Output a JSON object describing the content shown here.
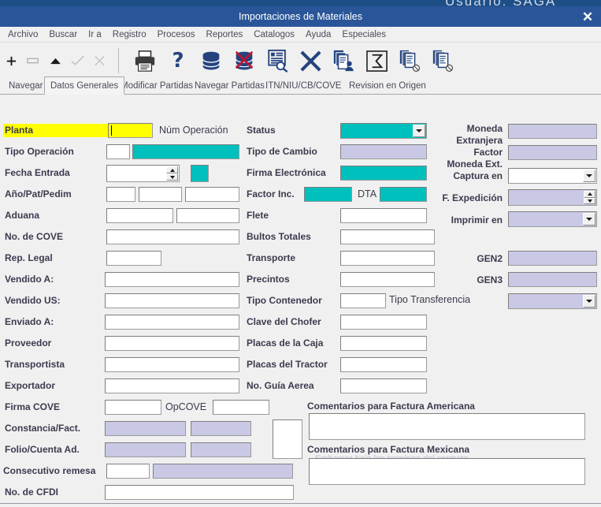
{
  "window": {
    "title": "Importaciones de Materiales",
    "close_label": "✕",
    "ghost_behind_title": "Usuario:  SAGA"
  },
  "menu": {
    "items": [
      "Archivo",
      "Buscar",
      "Ir a",
      "Registro",
      "Procesos",
      "Reportes",
      "Catalogos",
      "Ayuda",
      "Especiales"
    ]
  },
  "toolbar": {
    "nav_buttons": [
      {
        "name": "add-record-icon",
        "glyph": "➕",
        "enabled": true
      },
      {
        "name": "delete-record-icon",
        "glyph": "▭",
        "enabled": false
      },
      {
        "name": "previous-record-icon",
        "glyph": "▲",
        "enabled": true
      },
      {
        "name": "commit-icon",
        "glyph": "✓",
        "enabled": false
      },
      {
        "name": "rollback-icon",
        "glyph": "✗",
        "enabled": false
      }
    ],
    "action_buttons": [
      {
        "name": "print-icon"
      },
      {
        "name": "help-question-icon"
      },
      {
        "name": "database-icon"
      },
      {
        "name": "database-delete-icon"
      },
      {
        "name": "query-list-icon"
      },
      {
        "name": "close-x-icon"
      },
      {
        "name": "document-user-icon"
      },
      {
        "name": "sum-sigma-icon"
      },
      {
        "name": "copy-cancel-icon"
      },
      {
        "name": "document-cancel-icon"
      }
    ]
  },
  "tabs": [
    {
      "label": "Navegar",
      "selected": false
    },
    {
      "label": "Datos Generales",
      "selected": true
    },
    {
      "label": "Modificar Partidas",
      "selected": false
    },
    {
      "label": "Navegar Partidas",
      "selected": false
    },
    {
      "label": "ITN/NIU/CB/COVE",
      "selected": false
    },
    {
      "label": "Revision en Origen",
      "selected": false
    }
  ],
  "form": {
    "col_left": [
      {
        "label": "Planta",
        "value": "",
        "style": "yellow",
        "highlight": true
      },
      {
        "label": "Tipo Operación",
        "value": ""
      },
      {
        "label": "Fecha Entrada",
        "value": ""
      },
      {
        "label": "Año/Pat/Pedim",
        "value": ""
      },
      {
        "label": "Aduana",
        "value": ""
      },
      {
        "label": "No. de COVE",
        "value": ""
      },
      {
        "label": "Rep. Legal",
        "value": ""
      },
      {
        "label": "Vendido A:",
        "value": ""
      },
      {
        "label": "Vendido US:",
        "value": ""
      },
      {
        "label": "Enviado A:",
        "value": ""
      },
      {
        "label": "Proveedor",
        "value": ""
      },
      {
        "label": "Transportista",
        "value": ""
      },
      {
        "label": "Exportador",
        "value": ""
      },
      {
        "label": "Firma COVE",
        "value": ""
      },
      {
        "label": "Constancia/Fact.",
        "value": ""
      },
      {
        "label": "Folio/Cuenta Ad.",
        "value": ""
      },
      {
        "label": "Consecutivo remesa",
        "value": ""
      },
      {
        "label": "No. de CFDI",
        "value": ""
      }
    ],
    "inline_labels": {
      "num_operacion": "Núm Operación",
      "opcove": "OpCOVE",
      "dta": "DTA",
      "tipo_transferencia": "Tipo Transferencia"
    },
    "col_mid": [
      {
        "label": "Status",
        "value": ""
      },
      {
        "label": "Tipo de Cambio",
        "value": ""
      },
      {
        "label": "Firma Electrónica",
        "value": ""
      },
      {
        "label": "Factor Inc.",
        "value": ""
      },
      {
        "label": "Flete",
        "value": ""
      },
      {
        "label": "Bultos Totales",
        "value": ""
      },
      {
        "label": "Transporte",
        "value": ""
      },
      {
        "label": "Precintos",
        "value": ""
      },
      {
        "label": "Tipo Contenedor",
        "value": ""
      },
      {
        "label": "Clave del Chofer",
        "value": ""
      },
      {
        "label": "Placas de la Caja",
        "value": ""
      },
      {
        "label": "Placas del Tractor",
        "value": ""
      },
      {
        "label": "No. Guía Aerea",
        "value": ""
      }
    ],
    "col_right": [
      {
        "label": "Moneda\nExtranjera",
        "value": ""
      },
      {
        "label": "Factor\nMoneda Ext.",
        "value": ""
      },
      {
        "label": "Captura en",
        "value": ""
      },
      {
        "label": "F. Expedición",
        "value": ""
      },
      {
        "label": "Imprimir en",
        "value": ""
      },
      {
        "label": "GEN2",
        "value": ""
      },
      {
        "label": "GEN3",
        "value": ""
      }
    ],
    "right_lines": {
      "moneda_l1": "Moneda",
      "moneda_l2": "Extranjera",
      "factor_l1": "Factor",
      "factor_l2": "Moneda Ext.",
      "captura": "Captura en",
      "fexped": "F. Expedición",
      "imprimir": "Imprimir en",
      "gen2": "GEN2",
      "gen3": "GEN3"
    },
    "comments": {
      "american_label": "Comentarios para Factura Americana",
      "american_value": "",
      "mexican_label": "Comentarios para Factura Mexicana",
      "mexican_value": "",
      "ghost_text": "Embarcar bajo los terminos del contrato"
    }
  },
  "colors": {
    "titlebar": "#2a5699",
    "teal": "#00c0bd",
    "lavender": "#c9c9e6",
    "yellow": "#ffff00",
    "panel": "#f0f0f0",
    "icon_blue": "#24437e"
  }
}
